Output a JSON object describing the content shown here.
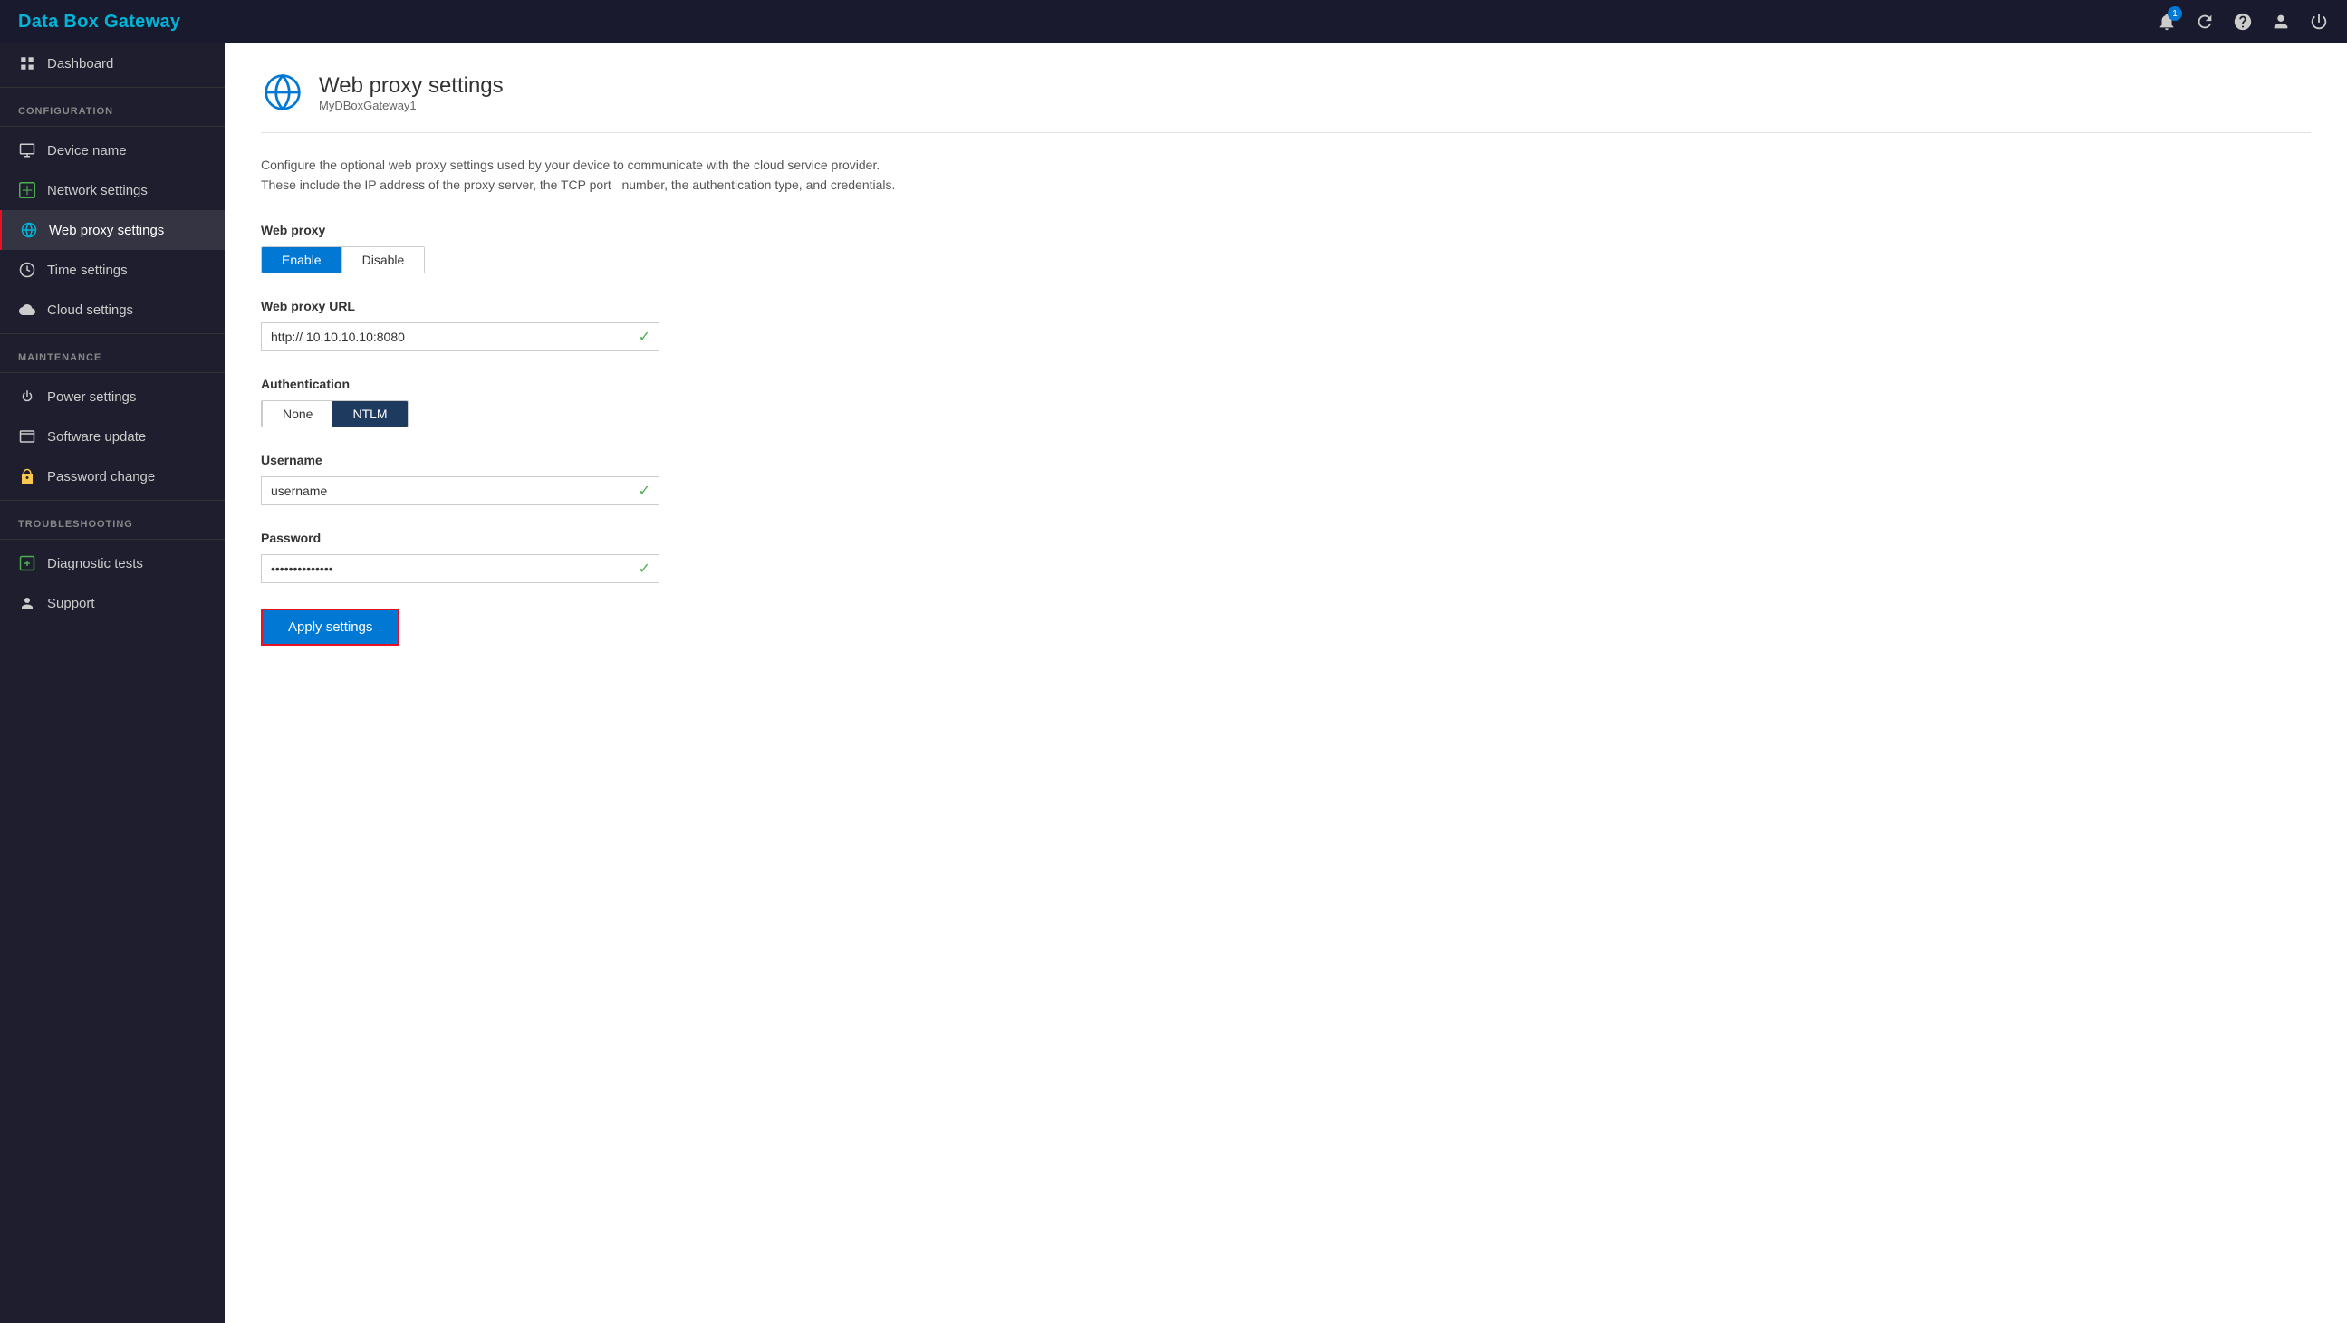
{
  "app": {
    "title": "Data Box Gateway"
  },
  "topbar": {
    "notification_count": "1",
    "icons": [
      "bell",
      "refresh",
      "help",
      "account",
      "power"
    ]
  },
  "sidebar": {
    "dashboard": "Dashboard",
    "configuration_label": "CONFIGURATION",
    "device_name": "Device name",
    "network_settings": "Network settings",
    "web_proxy_settings": "Web proxy settings",
    "time_settings": "Time settings",
    "cloud_settings": "Cloud settings",
    "maintenance_label": "MAINTENANCE",
    "power_settings": "Power settings",
    "software_update": "Software update",
    "password_change": "Password change",
    "troubleshooting_label": "TROUBLESHOOTING",
    "diagnostic_tests": "Diagnostic tests",
    "support": "Support"
  },
  "page": {
    "title": "Web proxy settings",
    "subtitle": "MyDBoxGateway1",
    "description": "Configure the optional web proxy settings used by your device to communicate with the cloud service provider.\nThese include the IP address of the proxy server, the TCP port  number, the authentication type, and credentials."
  },
  "form": {
    "web_proxy_label": "Web proxy",
    "enable_btn": "Enable",
    "disable_btn": "Disable",
    "web_proxy_url_label": "Web proxy URL",
    "web_proxy_url_value": "http:// 10.10.10.10:8080",
    "authentication_label": "Authentication",
    "none_btn": "None",
    "ntlm_btn": "NTLM",
    "username_label": "Username",
    "username_value": "username",
    "password_label": "Password",
    "password_value": "••••••••••••••",
    "apply_btn": "Apply settings"
  }
}
